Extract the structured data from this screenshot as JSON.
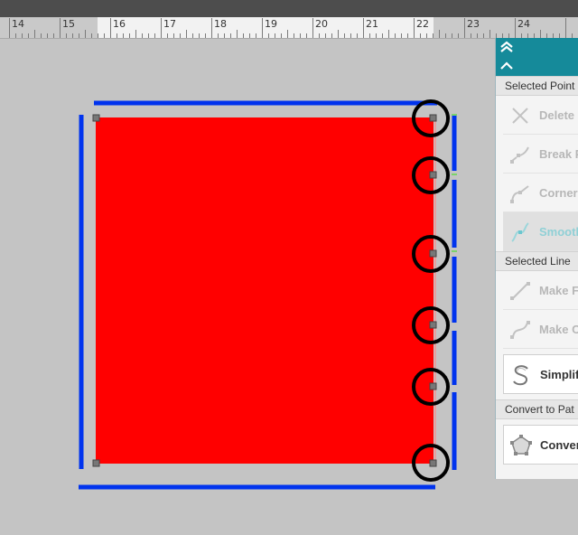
{
  "ruler": {
    "labels": [
      "14",
      "15",
      "16",
      "17",
      "18",
      "19",
      "20",
      "21",
      "22",
      "23",
      "24"
    ]
  },
  "panel": {
    "sections": {
      "selected_point": "Selected Point",
      "selected_line": "Selected Line",
      "convert_to_path": "Convert to Pat"
    },
    "buttons": {
      "delete": "Delete",
      "break": "Break P",
      "corner": "Corner",
      "smooth": "Smooth",
      "make_flat": "Make F",
      "make_curved": "Make C",
      "simplify": "Simplif",
      "convert": "Conver"
    }
  },
  "colors": {
    "shape_fill": "#ff0000",
    "bounds_blue": "#0033ee",
    "panel_teal": "#158a9a",
    "highlight_circle": "#000000"
  }
}
